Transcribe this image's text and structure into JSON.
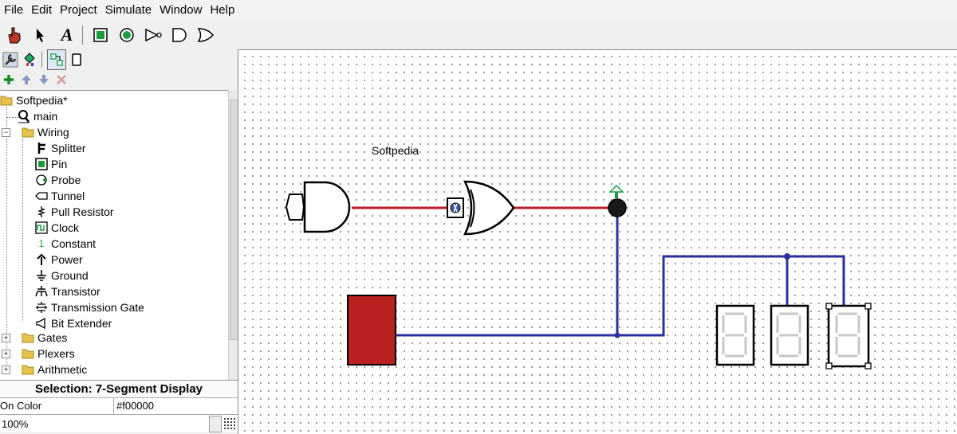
{
  "menu": [
    "File",
    "Edit",
    "Project",
    "Simulate",
    "Window",
    "Help"
  ],
  "toolbar": {
    "text_tool_glyph": "A",
    "icons": [
      "poke-tool-icon",
      "select-tool-icon",
      "text-tool-icon",
      "input-pin-icon",
      "output-pin-icon",
      "not-gate-icon",
      "and-gate-icon",
      "or-gate-icon"
    ]
  },
  "explorer": {
    "toolbar_icons": [
      "add-circuit-icon",
      "move-up-icon",
      "move-down-icon",
      "delete-icon"
    ],
    "root": "Softpedia*",
    "main": "main",
    "wiring": "Wiring",
    "wiring_items": [
      "Splitter",
      "Pin",
      "Probe",
      "Tunnel",
      "Pull Resistor",
      "Clock",
      "Constant",
      "Power",
      "Ground",
      "Transistor",
      "Transmission Gate",
      "Bit Extender"
    ],
    "folders": [
      "Gates",
      "Plexers",
      "Arithmetic"
    ],
    "constant_glyph": "1"
  },
  "selection": {
    "title": "Selection: 7-Segment Display",
    "attr_name": "On Color",
    "attr_value": "#f00000"
  },
  "zoom": "100%",
  "canvas": {
    "label": "Softpedia"
  },
  "colors": {
    "wire_true": "#b8211f",
    "wire_bus": "#2a2f9e",
    "led_fill": "#b8211f",
    "probe_green": "#1a9b3c"
  }
}
